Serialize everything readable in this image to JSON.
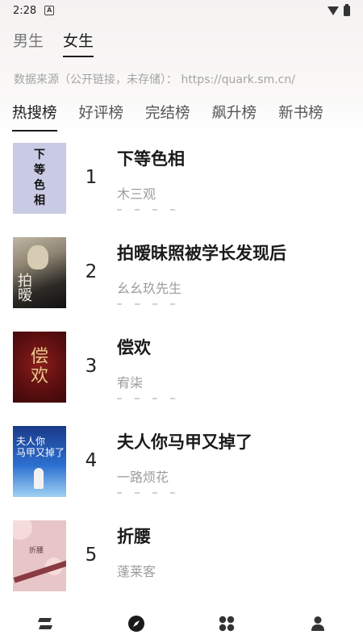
{
  "status_bar": {
    "time": "2:28",
    "notification_icon": "a-notification-icon"
  },
  "gender_tabs": [
    {
      "label": "男生",
      "active": false
    },
    {
      "label": "女生",
      "active": true
    }
  ],
  "source_note": "数据来源（公开链接，未存储）：  https://quark.sm.cn/",
  "rank_tabs": [
    {
      "label": "热搜榜",
      "active": true
    },
    {
      "label": "好评榜",
      "active": false
    },
    {
      "label": "完结榜",
      "active": false
    },
    {
      "label": "飙升榜",
      "active": false
    },
    {
      "label": "新书榜",
      "active": false
    }
  ],
  "books": [
    {
      "rank": "1",
      "title": "下等色相",
      "author": "木三观",
      "cover_text": "下等色相"
    },
    {
      "rank": "2",
      "title": "拍暧昧照被学长发现后",
      "author": "幺幺玖先生",
      "cover_text": "拍暧"
    },
    {
      "rank": "3",
      "title": "偿欢",
      "author": "宥柒",
      "cover_text": "偿欢"
    },
    {
      "rank": "4",
      "title": "夫人你马甲又掉了",
      "author": "一路烦花",
      "cover_text": "夫人你马甲又掉了"
    },
    {
      "rank": "5",
      "title": "折腰",
      "author": "蓬莱客",
      "cover_text": "折腰"
    }
  ],
  "bottom_nav": [
    {
      "name": "bookshelf-icon",
      "active": false
    },
    {
      "name": "compass-icon",
      "active": true
    },
    {
      "name": "grid-icon",
      "active": false
    },
    {
      "name": "person-icon",
      "active": false
    }
  ],
  "colors": {
    "accent": "#1a1a1a",
    "muted": "#9c9c9c",
    "source": "#a4a4a4"
  }
}
